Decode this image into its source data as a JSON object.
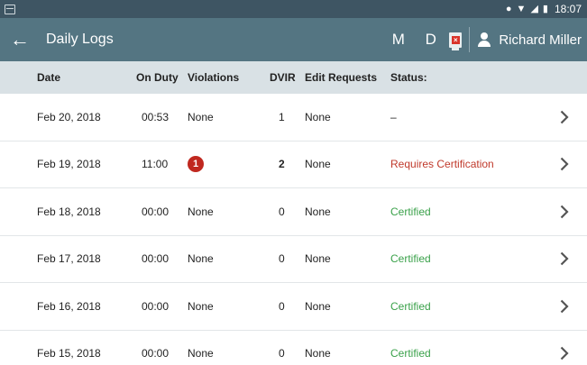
{
  "status_bar": {
    "time": "18:07"
  },
  "app_bar": {
    "back_icon": "arrow-left-icon",
    "title": "Daily Logs",
    "mode_m": "M",
    "mode_d": "D",
    "user_name": "Richard Miller"
  },
  "columns": {
    "date": "Date",
    "on_duty": "On Duty",
    "violations": "Violations",
    "dvir": "DVIR",
    "edit_requests": "Edit Requests",
    "status": "Status:"
  },
  "rows": [
    {
      "date": "Feb 20, 2018",
      "on_duty": "00:53",
      "violations": "None",
      "dvir": "1",
      "edit_requests": "None",
      "status": "–"
    },
    {
      "date": "Feb 19, 2018",
      "on_duty": "11:00",
      "violations": "1",
      "dvir": "2",
      "edit_requests": "None",
      "status": "Requires Certification"
    },
    {
      "date": "Feb 18, 2018",
      "on_duty": "00:00",
      "violations": "None",
      "dvir": "0",
      "edit_requests": "None",
      "status": "Certified"
    },
    {
      "date": "Feb 17, 2018",
      "on_duty": "00:00",
      "violations": "None",
      "dvir": "0",
      "edit_requests": "None",
      "status": "Certified"
    },
    {
      "date": "Feb 16, 2018",
      "on_duty": "00:00",
      "violations": "None",
      "dvir": "0",
      "edit_requests": "None",
      "status": "Certified"
    },
    {
      "date": "Feb 15, 2018",
      "on_duty": "00:00",
      "violations": "None",
      "dvir": "0",
      "edit_requests": "None",
      "status": "Certified"
    }
  ],
  "colors": {
    "app_bar": "#547582",
    "status_bar": "#3e5563",
    "header_row": "#d9e1e5",
    "violation_badge": "#c0281f",
    "requires_certification": "#c0392b",
    "certified": "#3aa14a"
  }
}
